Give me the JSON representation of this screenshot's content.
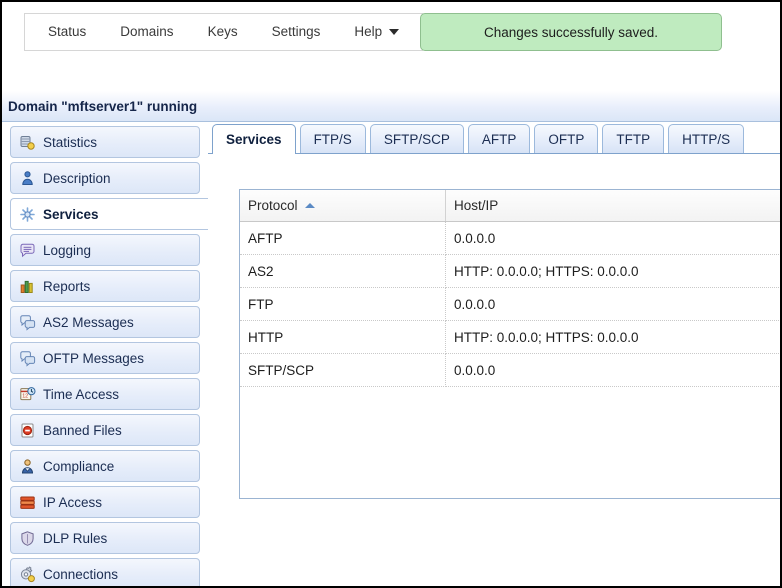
{
  "window": {
    "title": "Domain \"mftserver1\" running"
  },
  "menubar": {
    "items": [
      {
        "label": "Status",
        "name": "menu-status"
      },
      {
        "label": "Domains",
        "name": "menu-domains"
      },
      {
        "label": "Keys",
        "name": "menu-keys"
      },
      {
        "label": "Settings",
        "name": "menu-settings"
      },
      {
        "label": "Help",
        "name": "menu-help",
        "caret": true
      }
    ]
  },
  "alert": {
    "message": "Changes successfully saved.",
    "background": "#bfebbf",
    "border": "#8fbf8f"
  },
  "sidebar": {
    "items": [
      {
        "label": "Statistics",
        "icon": "statistics-icon",
        "selected": false
      },
      {
        "label": "Description",
        "icon": "description-icon",
        "selected": false
      },
      {
        "label": "Services",
        "icon": "services-icon",
        "selected": true
      },
      {
        "label": "Logging",
        "icon": "logging-icon",
        "selected": false
      },
      {
        "label": "Reports",
        "icon": "reports-icon",
        "selected": false
      },
      {
        "label": "AS2 Messages",
        "icon": "as2-messages-icon",
        "selected": false
      },
      {
        "label": "OFTP Messages",
        "icon": "oftp-messages-icon",
        "selected": false
      },
      {
        "label": "Time Access",
        "icon": "time-access-icon",
        "selected": false
      },
      {
        "label": "Banned Files",
        "icon": "banned-files-icon",
        "selected": false
      },
      {
        "label": "Compliance",
        "icon": "compliance-icon",
        "selected": false
      },
      {
        "label": "IP Access",
        "icon": "ip-access-icon",
        "selected": false
      },
      {
        "label": "DLP Rules",
        "icon": "dlp-rules-icon",
        "selected": false
      },
      {
        "label": "Connections",
        "icon": "connections-icon",
        "selected": false
      }
    ]
  },
  "tabs": [
    {
      "label": "Services",
      "active": true
    },
    {
      "label": "FTP/S",
      "active": false
    },
    {
      "label": "SFTP/SCP",
      "active": false
    },
    {
      "label": "AFTP",
      "active": false
    },
    {
      "label": "OFTP",
      "active": false
    },
    {
      "label": "TFTP",
      "active": false
    },
    {
      "label": "HTTP/S",
      "active": false
    }
  ],
  "table": {
    "columns": [
      {
        "label": "Protocol",
        "sort": "asc"
      },
      {
        "label": "Host/IP",
        "sort": null
      }
    ],
    "rows": [
      {
        "protocol": "AFTP",
        "hostip": "0.0.0.0"
      },
      {
        "protocol": "AS2",
        "hostip": "HTTP: 0.0.0.0; HTTPS: 0.0.0.0"
      },
      {
        "protocol": "FTP",
        "hostip": "0.0.0.0"
      },
      {
        "protocol": "HTTP",
        "hostip": "HTTP: 0.0.0.0; HTTPS: 0.0.0.0"
      },
      {
        "protocol": "SFTP/SCP",
        "hostip": "0.0.0.0"
      }
    ]
  }
}
